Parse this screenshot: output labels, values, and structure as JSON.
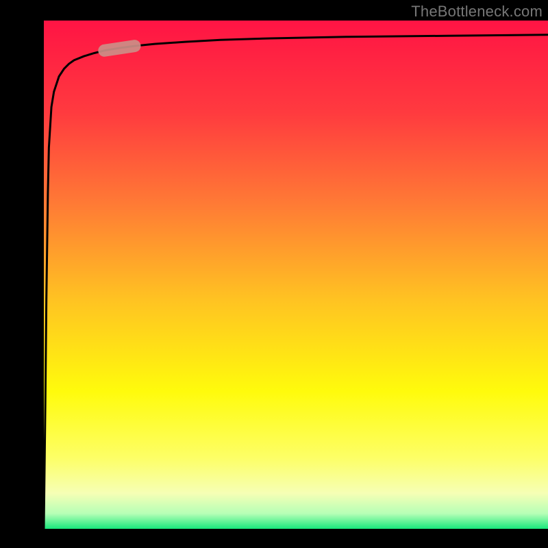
{
  "watermark": "TheBottleneck.com",
  "chart_data": {
    "type": "line",
    "title": "",
    "xlabel": "",
    "ylabel": "",
    "xlim": [
      0,
      100
    ],
    "ylim": [
      0,
      100
    ],
    "grid": false,
    "legend": false,
    "series": [
      {
        "name": "bottleneck-curve",
        "x": [
          0.0,
          0.3,
          0.5,
          0.8,
          1.0,
          1.5,
          2.0,
          3.0,
          4.0,
          5.0,
          6.0,
          8.0,
          10.0,
          12.0,
          15.0,
          18.0,
          22.0,
          28.0,
          35.0,
          45.0,
          60.0,
          80.0,
          100.0
        ],
        "y": [
          0.0,
          25.0,
          45.0,
          66.0,
          75.0,
          83.0,
          86.0,
          89.0,
          90.5,
          91.5,
          92.2,
          93.0,
          93.6,
          94.1,
          94.6,
          95.0,
          95.4,
          95.8,
          96.2,
          96.5,
          96.8,
          97.0,
          97.2
        ]
      }
    ],
    "marker": {
      "name": "highlight-segment",
      "x_range": [
        12,
        18
      ],
      "y_range": [
        94.1,
        95.0
      ],
      "color": "#cc8e87"
    },
    "background_gradient": {
      "stops": [
        {
          "pos": 0.0,
          "color": "#ff1444"
        },
        {
          "pos": 0.18,
          "color": "#ff3a3f"
        },
        {
          "pos": 0.36,
          "color": "#ff7a35"
        },
        {
          "pos": 0.55,
          "color": "#ffc322"
        },
        {
          "pos": 0.73,
          "color": "#fffb0c"
        },
        {
          "pos": 0.86,
          "color": "#fdff66"
        },
        {
          "pos": 0.93,
          "color": "#f6ffb5"
        },
        {
          "pos": 0.97,
          "color": "#b6ffb6"
        },
        {
          "pos": 1.0,
          "color": "#17e87b"
        }
      ]
    }
  }
}
